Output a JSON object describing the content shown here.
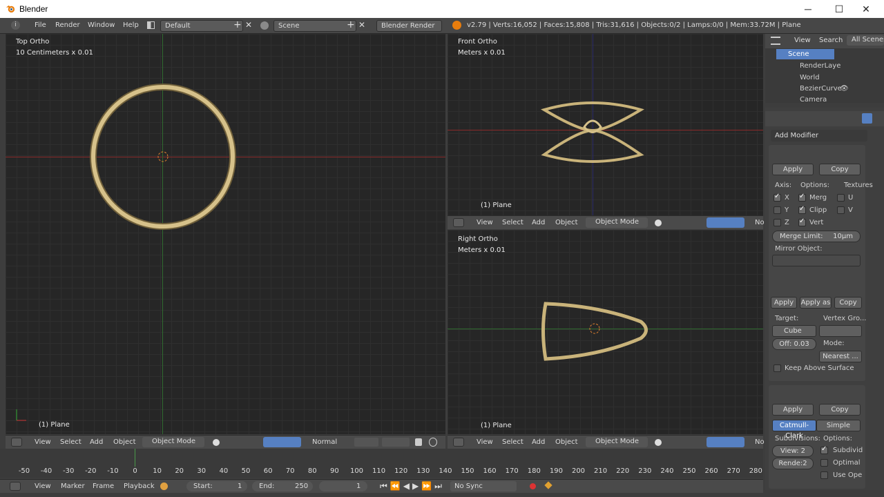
{
  "window": {
    "title": "Blender",
    "min": "─",
    "max": "☐",
    "close": "✕"
  },
  "menus": {
    "file": "File",
    "render": "Render",
    "window": "Window",
    "help": "Help"
  },
  "layout": "Default",
  "scene": "Scene",
  "engine": "Blender Render",
  "stats": "v2.79 | Verts:16,052 | Faces:15,808 | Tris:31,616 | Objects:0/2 | Lamps:0/0 | Mem:33.72M | Plane",
  "top_view": {
    "name": "Top Ortho",
    "scale": "10 Centimeters x 0.01",
    "object": "(1) Plane"
  },
  "front_view": {
    "name": "Front Ortho",
    "scale": "Meters x 0.01",
    "object": "(1) Plane"
  },
  "right_view": {
    "name": "Right Ortho",
    "scale": "Meters x 0.01",
    "object": "(1) Plane"
  },
  "vp_header": {
    "view": "View",
    "select": "Select",
    "add": "Add",
    "object": "Object",
    "mode": "Object Mode",
    "orientation": "Normal",
    "no": "No"
  },
  "outliner": {
    "view": "View",
    "search": "Search",
    "all_scenes": "All Scenes",
    "items": [
      "Scene",
      "RenderLaye",
      "World",
      "BezierCurve",
      "Camera"
    ]
  },
  "properties": {
    "add_modifier": "Add Modifier",
    "mirror": {
      "apply": "Apply",
      "copy": "Copy",
      "axis": "Axis:",
      "options": "Options:",
      "textures": "Textures",
      "x": "X",
      "y": "Y",
      "z": "Z",
      "merg": "Merg",
      "clipp": "Clipp",
      "vert": "Vert",
      "u": "U",
      "v": "V",
      "merge_limit": "Merge Limit:",
      "merge_value": "10µm",
      "mirror_object": "Mirror Object:"
    },
    "shrink": {
      "apply": "Apply",
      "apply_as": "Apply as",
      "copy": "Copy",
      "target": "Target:",
      "vertex_group": "Vertex Gro...",
      "cube": "Cube",
      "offset": "Off: 0.03",
      "mode": "Mode:",
      "nearest": "Nearest ...",
      "keep_above": "Keep Above Surface"
    },
    "subsurf": {
      "apply": "Apply",
      "copy": "Copy",
      "catmull": "Catmull-Clark",
      "simple": "Simple",
      "subdivisions": "Subdivisions:",
      "options": "Options:",
      "view": "View: 2",
      "render": "Rende:2",
      "subdivid": "Subdivid",
      "optimal": "Optimal",
      "use_ope": "Use Ope"
    }
  },
  "timeline": {
    "ticks": [
      "-50",
      "-40",
      "-30",
      "-20",
      "-10",
      "0",
      "10",
      "20",
      "30",
      "40",
      "50",
      "60",
      "70",
      "80",
      "90",
      "100",
      "110",
      "120",
      "130",
      "140",
      "150",
      "160",
      "170",
      "180",
      "190",
      "200",
      "210",
      "220",
      "230",
      "240",
      "250",
      "260",
      "270",
      "280"
    ],
    "view": "View",
    "marker": "Marker",
    "frame": "Frame",
    "playback": "Playback",
    "start_label": "Start:",
    "start": "1",
    "end_label": "End:",
    "end": "250",
    "current": "1",
    "sync": "No Sync"
  },
  "colors": {
    "ring": "#c9b37a",
    "x_axis": "#b03030",
    "y_axis": "#3a8a3a",
    "accent": "#5680c2"
  }
}
